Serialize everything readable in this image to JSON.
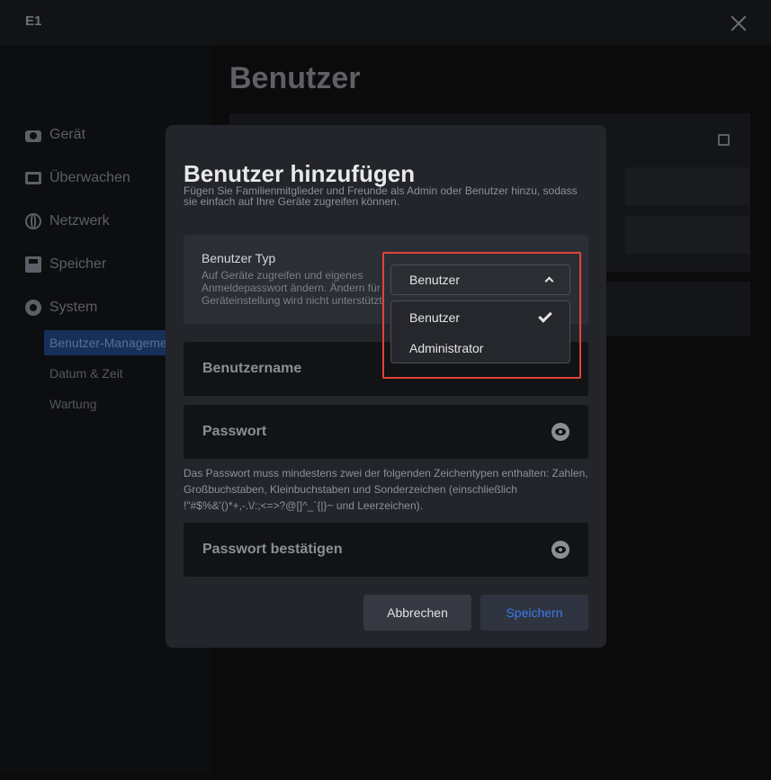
{
  "app": {
    "title": "E1"
  },
  "sidebar": {
    "items": [
      {
        "label": "Gerät",
        "icon": "camera-icon"
      },
      {
        "label": "Überwachen",
        "icon": "monitor-icon"
      },
      {
        "label": "Netzwerk",
        "icon": "globe-icon"
      },
      {
        "label": "Speicher",
        "icon": "storage-icon"
      },
      {
        "label": "System",
        "icon": "gear-icon"
      }
    ],
    "subitems": [
      {
        "label": "Benutzer-Management",
        "active": true
      },
      {
        "label": "Datum & Zeit",
        "active": false
      },
      {
        "label": "Wartung",
        "active": false
      }
    ]
  },
  "main": {
    "title": "Benutzer"
  },
  "modal": {
    "title": "Benutzer hinzufügen",
    "subtitle": "Fügen Sie Familienmitglieder und Freunde als Admin oder Benutzer hinzu, sodass sie einfach auf Ihre Geräte zugreifen können.",
    "user_type": {
      "label": "Benutzer Typ",
      "description_lines": [
        "Auf Geräte zugreifen und eigenes",
        "Anmeldepasswort ändern. Ändern für",
        "Geräteinstellung wird nicht unterstützt."
      ],
      "selected": "Benutzer",
      "options": [
        {
          "label": "Benutzer",
          "selected": true
        },
        {
          "label": "Administrator",
          "selected": false
        }
      ]
    },
    "username_placeholder": "Benutzername",
    "password_placeholder": "Passwort",
    "password_hint": "Das Passwort muss mindestens zwei der folgenden Zeichentypen enthalten: Zahlen, Großbuchstaben, Kleinbuchstaben und Sonderzeichen (einschließlich !\"#$%&'()*+,-.\\/:;<=>?@[]^_`{|}~ und Leerzeichen).",
    "confirm_placeholder": "Passwort bestätigen",
    "cancel_label": "Abbrechen",
    "save_label": "Speichern"
  },
  "colors": {
    "accent": "#3a7bf0",
    "highlight_border": "#e0443b",
    "modal_bg": "#23252b"
  }
}
